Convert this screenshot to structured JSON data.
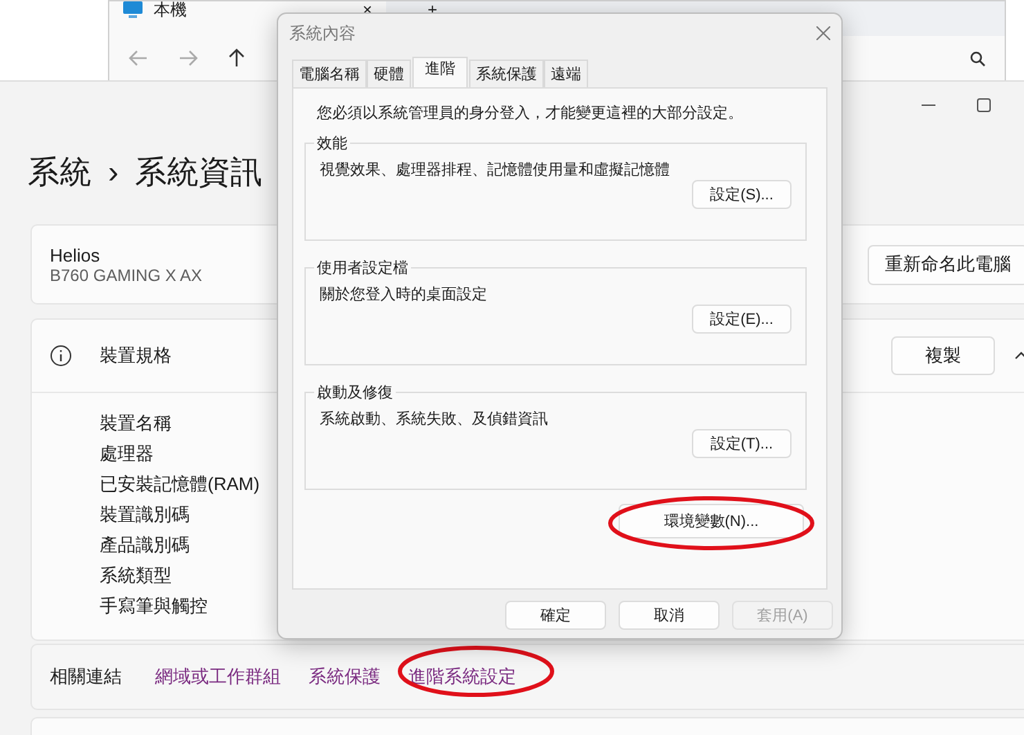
{
  "explorer": {
    "tab_title": "本機",
    "tab_close": "×",
    "new_tab": "+"
  },
  "settings": {
    "breadcrumb": [
      "系統",
      "系統資訊"
    ],
    "separator": "›",
    "device": {
      "name": "Helios",
      "model": "B760 GAMING X AX",
      "rename_button": "重新命名此電腦"
    },
    "specs": {
      "title": "裝置規格",
      "copy_button": "複製",
      "expanded": true,
      "rows": [
        "裝置名稱",
        "處理器",
        "已安裝記憶體(RAM)",
        "裝置識別碼",
        "產品識別碼",
        "系統類型",
        "手寫筆與觸控"
      ]
    },
    "related_links": {
      "label": "相關連結",
      "links": [
        {
          "text": "網域或工作群組",
          "highlighted": false
        },
        {
          "text": "系統保護",
          "highlighted": false
        },
        {
          "text": "進階系統設定",
          "highlighted": true
        }
      ]
    }
  },
  "dialog": {
    "title": "系統內容",
    "tabs": [
      {
        "label": "電腦名稱",
        "selected": false
      },
      {
        "label": "硬體",
        "selected": false
      },
      {
        "label": "進階",
        "selected": true
      },
      {
        "label": "系統保護",
        "selected": false
      },
      {
        "label": "遠端",
        "selected": false
      }
    ],
    "notice": "您必須以系統管理員的身分登入，才能變更這裡的大部分設定。",
    "groups": [
      {
        "title": "效能",
        "description": "視覺效果、處理器排程、記憶體使用量和虛擬記憶體",
        "button": "設定(S)..."
      },
      {
        "title": "使用者設定檔",
        "description": "關於您登入時的桌面設定",
        "button": "設定(E)..."
      },
      {
        "title": "啟動及修復",
        "description": "系統啟動、系統失敗、及偵錯資訊",
        "button": "設定(T)..."
      }
    ],
    "env_button": {
      "label": "環境變數(N)...",
      "highlighted": true
    },
    "buttons": [
      {
        "label": "確定",
        "disabled": false
      },
      {
        "label": "取消",
        "disabled": false
      },
      {
        "label": "套用(A)",
        "disabled": true
      }
    ]
  }
}
